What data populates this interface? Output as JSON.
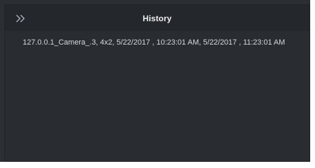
{
  "panel": {
    "title": "History",
    "collapse_icon": "double-chevron-right-icon"
  },
  "history": {
    "items": [
      {
        "label": "127.0.0.1_Camera_.3, 4x2, 5/22/2017 , 10:23:01 AM, 5/22/2017 , 11:23:01 AM"
      }
    ]
  },
  "colors": {
    "background": "#2b2e33",
    "header": "#24272b",
    "text": "#d6d9dd",
    "title": "#eef0f2"
  }
}
